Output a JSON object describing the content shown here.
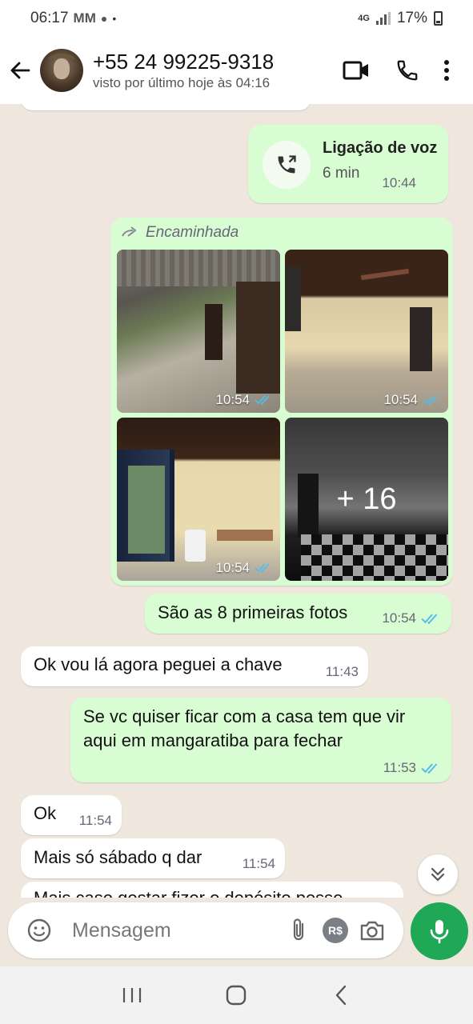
{
  "status_bar": {
    "time": "06:17",
    "notif_icons": "MM",
    "dot": "•",
    "network": "4G",
    "battery": "17%"
  },
  "header": {
    "contact_name": "+55 24 99225-9318",
    "last_seen": "visto por último hoje às 04:16"
  },
  "messages": {
    "call": {
      "title": "Ligação de voz",
      "duration": "6 min",
      "time": "10:44"
    },
    "forwarded": {
      "label": "Encaminhada",
      "photos": [
        {
          "time": "10:54"
        },
        {
          "time": "10:54"
        },
        {
          "time": "10:54"
        },
        {
          "more": "+ 16"
        }
      ]
    },
    "m1": {
      "text": "São as 8 primeiras fotos",
      "time": "10:54"
    },
    "m2": {
      "text": "Ok vou lá agora peguei a chave",
      "time": "11:43"
    },
    "m3": {
      "text": "Se vc quiser ficar com a casa tem que vir aqui em mangaratiba para fechar",
      "time": "11:53"
    },
    "m4": {
      "text": "Ok",
      "time": "11:54"
    },
    "m5": {
      "text": "Mais só sábado q dar",
      "time": "11:54"
    },
    "m6": {
      "text": "Mais caso gostar fizer o depósito posso"
    }
  },
  "input": {
    "placeholder": "Mensagem",
    "currency_label": "R$"
  },
  "colors": {
    "outgoing_bubble": "#d9fdd3",
    "incoming_bubble": "#ffffff",
    "background": "#efe7de",
    "accent_green": "#1fa855",
    "read_ticks": "#53bdeb"
  }
}
